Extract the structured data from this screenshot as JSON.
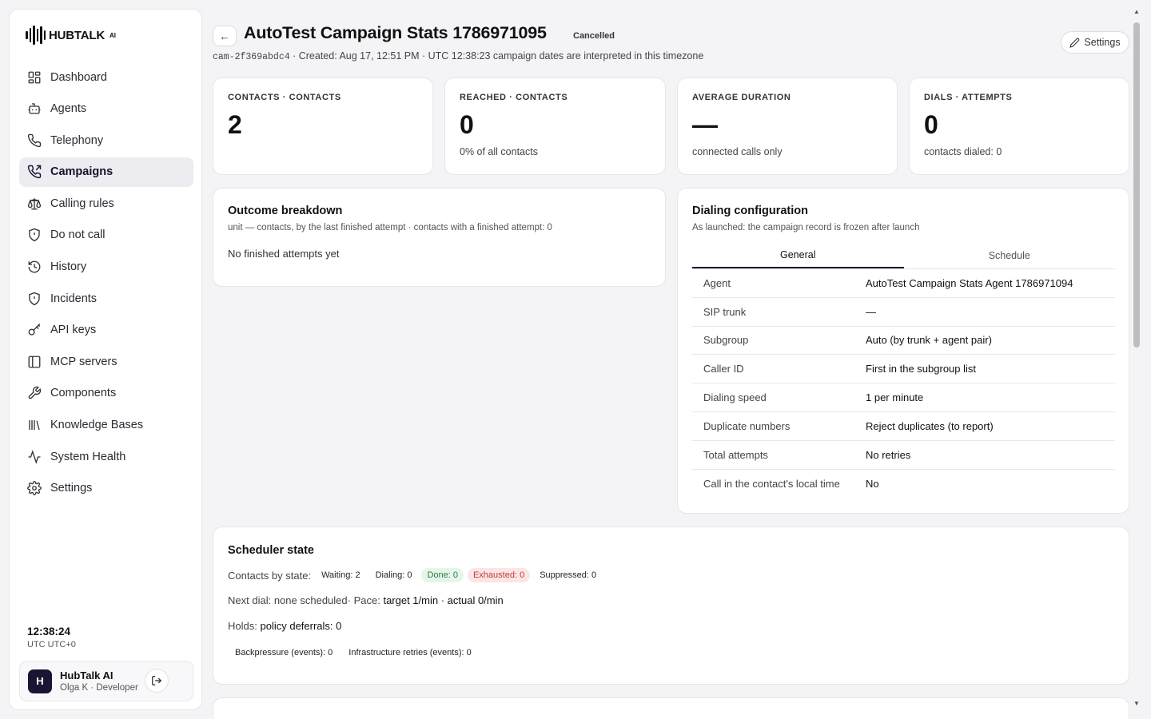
{
  "brand": {
    "name": "HUBTALK",
    "suffix": "AI"
  },
  "sidebar": {
    "items": [
      {
        "label": "Dashboard",
        "icon": "dashboard-icon"
      },
      {
        "label": "Agents",
        "icon": "bot-icon"
      },
      {
        "label": "Telephony",
        "icon": "phone-icon"
      },
      {
        "label": "Campaigns",
        "icon": "phone-outgoing-icon",
        "active": true
      },
      {
        "label": "Calling rules",
        "icon": "scale-icon"
      },
      {
        "label": "Do not call",
        "icon": "shield-icon"
      },
      {
        "label": "History",
        "icon": "history-icon"
      },
      {
        "label": "Incidents",
        "icon": "shield-alert-icon"
      },
      {
        "label": "API keys",
        "icon": "key-icon"
      },
      {
        "label": "MCP servers",
        "icon": "panel-icon"
      },
      {
        "label": "Components",
        "icon": "wrench-icon"
      },
      {
        "label": "Knowledge Bases",
        "icon": "library-icon"
      },
      {
        "label": "System Health",
        "icon": "activity-icon"
      },
      {
        "label": "Settings",
        "icon": "gear-icon"
      }
    ],
    "clock": {
      "time": "12:38:24",
      "zone": "UTC UTC+0"
    },
    "user": {
      "initial": "H",
      "name": "HubTalk AI",
      "role": "Olga K · Developer"
    }
  },
  "header": {
    "back_label": "←",
    "title": "AutoTest Campaign Stats 1786971095",
    "status": "Cancelled",
    "campaign_id": "cam-2f369abdc4",
    "meta": " · Created: Aug 17, 12:51 PM · UTC 12:38:23 campaign dates are interpreted in this timezone",
    "settings_label": "Settings"
  },
  "stats": [
    {
      "label": "CONTACTS · CONTACTS",
      "value": "2",
      "sub": ""
    },
    {
      "label": "REACHED · CONTACTS",
      "value": "0",
      "sub": "0% of all contacts"
    },
    {
      "label": "AVERAGE DURATION",
      "value": "—",
      "sub": "connected calls only"
    },
    {
      "label": "DIALS · ATTEMPTS",
      "value": "0",
      "sub": "contacts dialed: 0"
    }
  ],
  "outcome": {
    "title": "Outcome breakdown",
    "subtitle": "unit — contacts, by the last finished attempt · contacts with a finished attempt: 0",
    "empty": "No finished attempts yet"
  },
  "config": {
    "title": "Dialing configuration",
    "subtitle": "As launched: the campaign record is frozen after launch",
    "tabs": [
      "General",
      "Schedule"
    ],
    "rows": [
      {
        "key": "Agent",
        "value": "AutoTest Campaign Stats Agent 1786971094"
      },
      {
        "key": "SIP trunk",
        "value": "—"
      },
      {
        "key": "Subgroup",
        "value": "Auto (by trunk + agent pair)"
      },
      {
        "key": "Caller ID",
        "value": "First in the subgroup list"
      },
      {
        "key": "Dialing speed",
        "value": "1 per minute"
      },
      {
        "key": "Duplicate numbers",
        "value": "Reject duplicates (to report)"
      },
      {
        "key": "Total attempts",
        "value": "No retries"
      },
      {
        "key": "Call in the contact's local time",
        "value": "No"
      }
    ]
  },
  "scheduler": {
    "title": "Scheduler state",
    "states_label": "Contacts by state:",
    "pills": [
      {
        "label": "Waiting: 2",
        "kind": "plain"
      },
      {
        "label": "Dialing: 0",
        "kind": "plain"
      },
      {
        "label": "Done: 0",
        "kind": "done"
      },
      {
        "label": "Exhausted: 0",
        "kind": "exhausted"
      },
      {
        "label": "Suppressed: 0",
        "kind": "plain"
      }
    ],
    "next_dial_label": "Next dial:",
    "next_dial_value": "none scheduled",
    "pace_label": " · Pace:",
    "pace_value": "target 1/min · actual 0/min",
    "holds_label": "Holds:",
    "holds_value": "policy deferrals: 0",
    "extra": [
      "Backpressure (events): 0",
      "Infrastructure retries (events): 0"
    ]
  },
  "colors": {
    "accent": "#1a1533",
    "done": "#2f7a45",
    "exhausted": "#c23b3b"
  }
}
